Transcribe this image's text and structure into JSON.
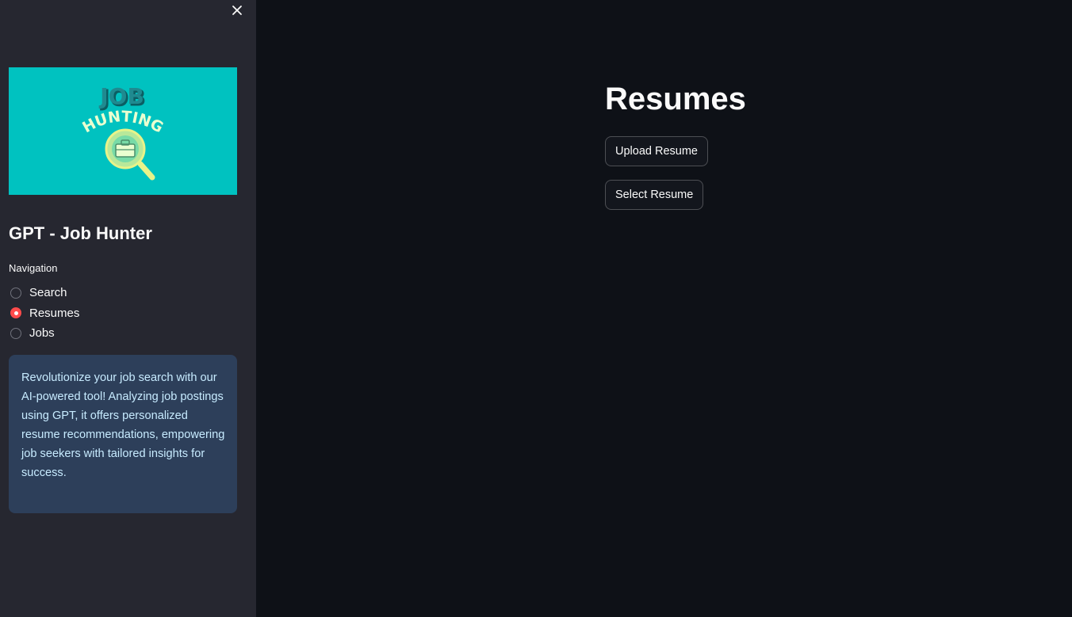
{
  "sidebar": {
    "close_icon": "close-icon",
    "logo": {
      "line1": "JOB",
      "line2": "HUNTING",
      "background": "#00c2c0",
      "icon": "magnifier-briefcase-icon"
    },
    "title": "GPT - Job Hunter",
    "nav": {
      "label": "Navigation",
      "items": [
        {
          "label": "Search",
          "selected": false
        },
        {
          "label": "Resumes",
          "selected": true
        },
        {
          "label": "Jobs",
          "selected": false
        }
      ]
    },
    "info": "Revolutionize your job search with our AI-powered tool! Analyzing job postings using GPT, it offers personalized resume recommendations, empowering job seekers with tailored insights for success."
  },
  "main": {
    "title": "Resumes",
    "buttons": {
      "upload": "Upload Resume",
      "select": "Select Resume"
    }
  },
  "colors": {
    "sidebar_bg": "#262730",
    "main_bg": "#0e1117",
    "accent": "#ff4b4b",
    "info_bg": "#2d3f5a",
    "info_text": "#c7ebff"
  }
}
